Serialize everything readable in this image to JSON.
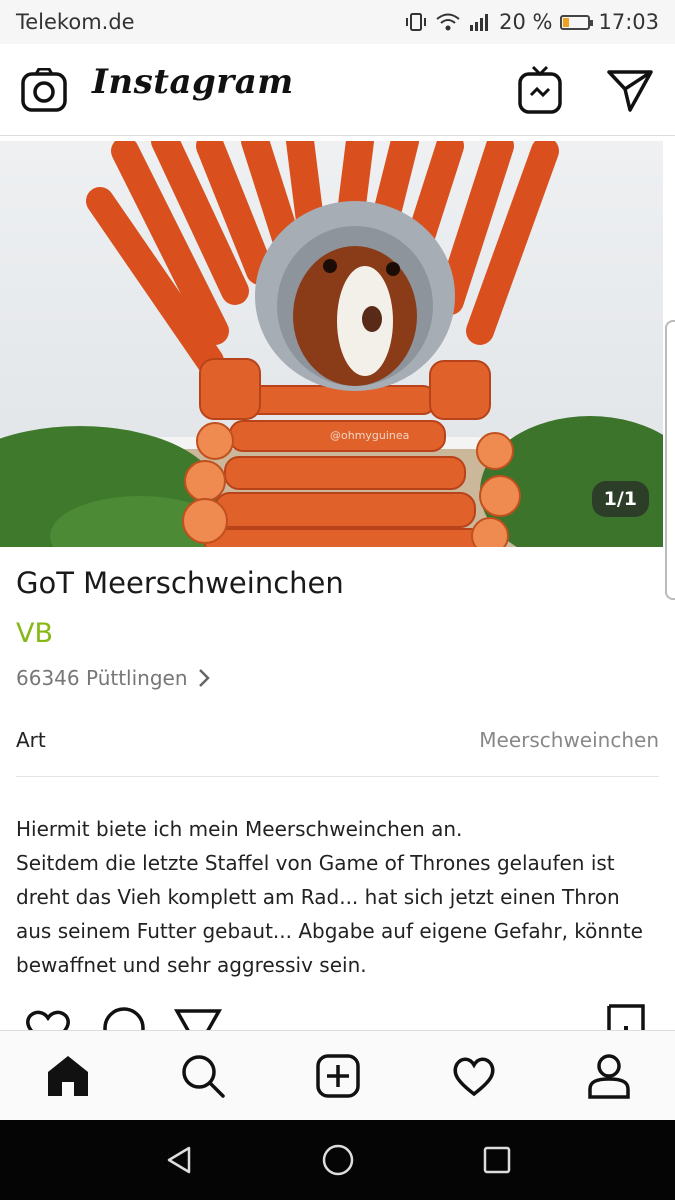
{
  "status": {
    "carrier": "Telekom.de",
    "battery": "20 %",
    "time": "17:03",
    "battery_level": 0.2
  },
  "app": {
    "name": "Instagram"
  },
  "photo": {
    "watermark": "@ohmyguinea",
    "counter": "1/1"
  },
  "listing": {
    "title": "GoT Meerschweinchen",
    "price": "VB",
    "location": "66346 Püttlingen",
    "attribute_label": "Art",
    "attribute_value": "Meerschweinchen",
    "description": "Hiermit biete ich mein Meerschweinchen an.\nSeitdem die letzte Staffel von Game of Thrones gelaufen ist\ndreht das Vieh komplett am Rad... hat sich jetzt einen Thron\naus seinem Futter gebaut... Abgabe auf eigene Gefahr, könnte\nbewaffnet und sehr aggressiv sein."
  },
  "colors": {
    "price": "#86b817"
  }
}
